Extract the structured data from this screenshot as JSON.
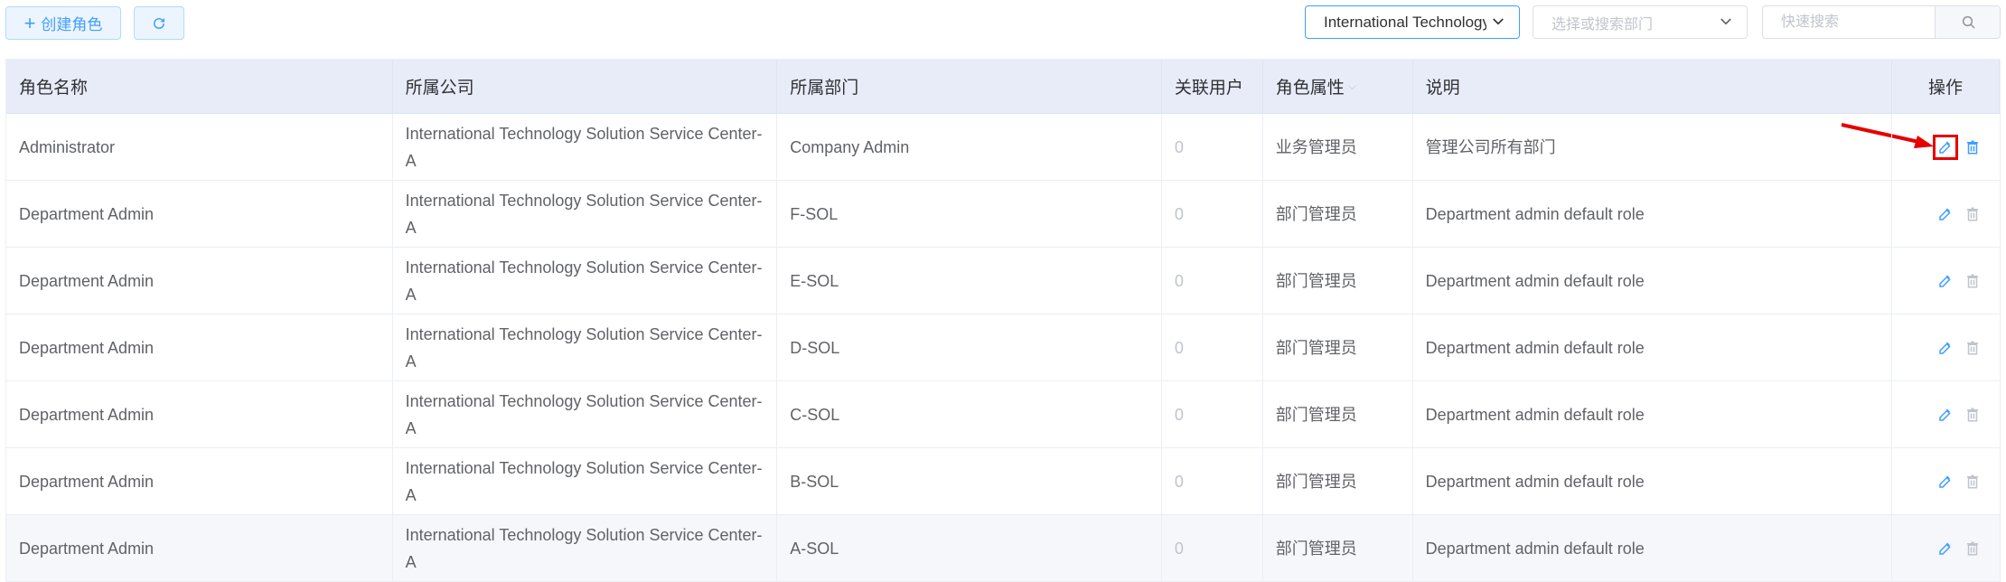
{
  "toolbar": {
    "create_label": "创建角色",
    "company_select_value": "International Technology Solution Service Center-A",
    "dept_select_placeholder": "选择或搜索部门",
    "search_placeholder": "快速搜索"
  },
  "table": {
    "headers": {
      "role_name": "角色名称",
      "company": "所属公司",
      "department": "所属部门",
      "linked_users": "关联用户",
      "role_type": "角色属性",
      "description": "说明",
      "actions": "操作"
    },
    "rows": [
      {
        "role_name": "Administrator",
        "company": "International Technology Solution Service Center-A",
        "department": "Company Admin",
        "linked_users": "0",
        "role_type": "业务管理员",
        "description": "管理公司所有部门"
      },
      {
        "role_name": "Department Admin",
        "company": "International Technology Solution Service Center-A",
        "department": "F-SOL",
        "linked_users": "0",
        "role_type": "部门管理员",
        "description": "Department admin default role"
      },
      {
        "role_name": "Department Admin",
        "company": "International Technology Solution Service Center-A",
        "department": "E-SOL",
        "linked_users": "0",
        "role_type": "部门管理员",
        "description": "Department admin default role"
      },
      {
        "role_name": "Department Admin",
        "company": "International Technology Solution Service Center-A",
        "department": "D-SOL",
        "linked_users": "0",
        "role_type": "部门管理员",
        "description": "Department admin default role"
      },
      {
        "role_name": "Department Admin",
        "company": "International Technology Solution Service Center-A",
        "department": "C-SOL",
        "linked_users": "0",
        "role_type": "部门管理员",
        "description": "Department admin default role"
      },
      {
        "role_name": "Department Admin",
        "company": "International Technology Solution Service Center-A",
        "department": "B-SOL",
        "linked_users": "0",
        "role_type": "部门管理员",
        "description": "Department admin default role"
      },
      {
        "role_name": "Department Admin",
        "company": "International Technology Solution Service Center-A",
        "department": "A-SOL",
        "linked_users": "0",
        "role_type": "部门管理员",
        "description": "Department admin default role"
      }
    ]
  },
  "colors": {
    "accent": "#409eff",
    "highlight": "#e60000",
    "header_bg": "#e8ecf9"
  }
}
